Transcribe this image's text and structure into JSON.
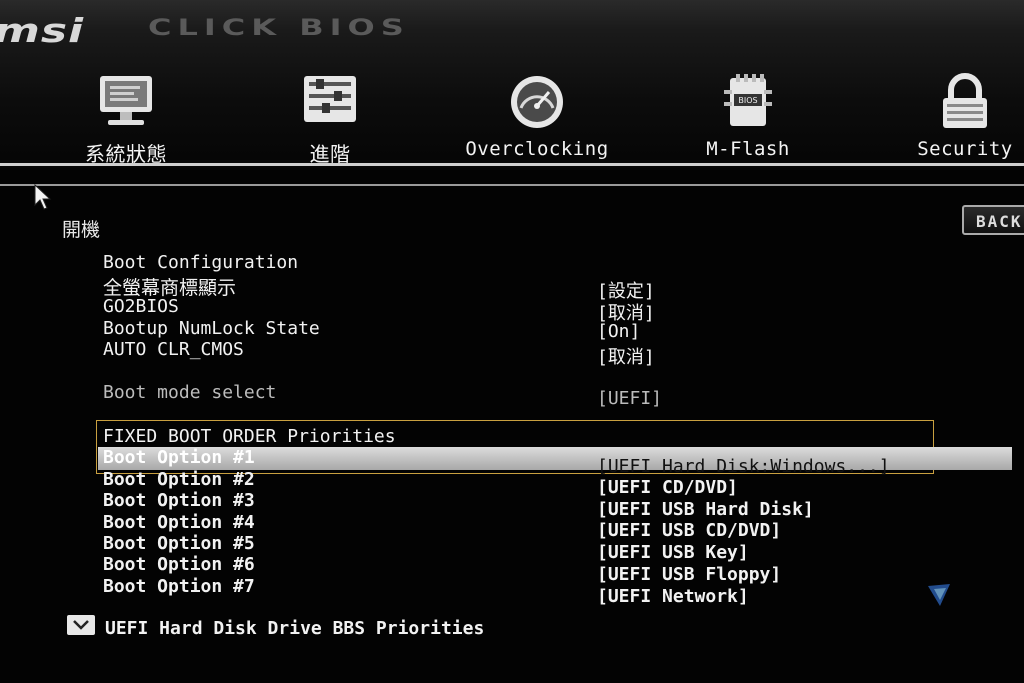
{
  "brand": {
    "logo": "msi",
    "product": "CLICK BIOS"
  },
  "nav": [
    {
      "label": "系統狀態",
      "icon": "monitor-icon"
    },
    {
      "label": "進階",
      "icon": "sliders-icon"
    },
    {
      "label": "Overclocking",
      "icon": "gauge-icon"
    },
    {
      "label": "M-Flash",
      "icon": "bios-chip-icon"
    },
    {
      "label": "Security",
      "icon": "lock-icon"
    }
  ],
  "back_label": "BACK",
  "section_title": "開機",
  "boot_config": {
    "heading": "Boot Configuration",
    "items": [
      {
        "label": "全螢幕商標顯示",
        "value": "[設定]"
      },
      {
        "label": "GO2BIOS",
        "value": "[取消]"
      },
      {
        "label": "Bootup NumLock State",
        "value": "[On]"
      },
      {
        "label": "AUTO CLR_CMOS",
        "value": "[取消]"
      }
    ]
  },
  "boot_mode": {
    "label": "Boot mode select",
    "value": "[UEFI]"
  },
  "fixed_order": {
    "heading": "FIXED BOOT ORDER Priorities",
    "options": [
      {
        "label": "Boot Option #1",
        "value": "[UEFI Hard Disk:Windows...]"
      },
      {
        "label": "Boot Option #2",
        "value": "[UEFI CD/DVD]"
      },
      {
        "label": "Boot Option #3",
        "value": "[UEFI USB Hard Disk]"
      },
      {
        "label": "Boot Option #4",
        "value": "[UEFI USB CD/DVD]"
      },
      {
        "label": "Boot Option #5",
        "value": "[UEFI USB Key]"
      },
      {
        "label": "Boot Option #6",
        "value": "[UEFI USB Floppy]"
      },
      {
        "label": "Boot Option #7",
        "value": "[UEFI Network]"
      }
    ]
  },
  "bbs_link": "UEFI Hard Disk Drive BBS Priorities",
  "colors": {
    "background": "#030303",
    "selection": "#c8c8c8",
    "highlight_border": "#c9a040",
    "text": "#f2f2f2"
  }
}
